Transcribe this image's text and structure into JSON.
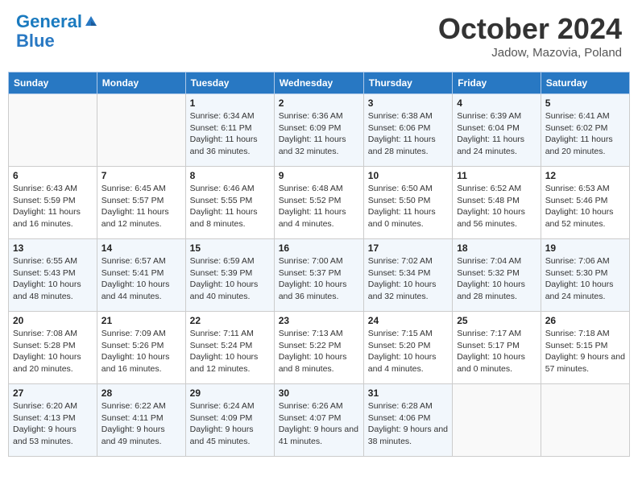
{
  "header": {
    "logo_line1": "General",
    "logo_line2": "Blue",
    "month_title": "October 2024",
    "subtitle": "Jadow, Mazovia, Poland"
  },
  "weekdays": [
    "Sunday",
    "Monday",
    "Tuesday",
    "Wednesday",
    "Thursday",
    "Friday",
    "Saturday"
  ],
  "weeks": [
    [
      {
        "day": "",
        "sunrise": "",
        "sunset": "",
        "daylight": ""
      },
      {
        "day": "",
        "sunrise": "",
        "sunset": "",
        "daylight": ""
      },
      {
        "day": "1",
        "sunrise": "Sunrise: 6:34 AM",
        "sunset": "Sunset: 6:11 PM",
        "daylight": "Daylight: 11 hours and 36 minutes."
      },
      {
        "day": "2",
        "sunrise": "Sunrise: 6:36 AM",
        "sunset": "Sunset: 6:09 PM",
        "daylight": "Daylight: 11 hours and 32 minutes."
      },
      {
        "day": "3",
        "sunrise": "Sunrise: 6:38 AM",
        "sunset": "Sunset: 6:06 PM",
        "daylight": "Daylight: 11 hours and 28 minutes."
      },
      {
        "day": "4",
        "sunrise": "Sunrise: 6:39 AM",
        "sunset": "Sunset: 6:04 PM",
        "daylight": "Daylight: 11 hours and 24 minutes."
      },
      {
        "day": "5",
        "sunrise": "Sunrise: 6:41 AM",
        "sunset": "Sunset: 6:02 PM",
        "daylight": "Daylight: 11 hours and 20 minutes."
      }
    ],
    [
      {
        "day": "6",
        "sunrise": "Sunrise: 6:43 AM",
        "sunset": "Sunset: 5:59 PM",
        "daylight": "Daylight: 11 hours and 16 minutes."
      },
      {
        "day": "7",
        "sunrise": "Sunrise: 6:45 AM",
        "sunset": "Sunset: 5:57 PM",
        "daylight": "Daylight: 11 hours and 12 minutes."
      },
      {
        "day": "8",
        "sunrise": "Sunrise: 6:46 AM",
        "sunset": "Sunset: 5:55 PM",
        "daylight": "Daylight: 11 hours and 8 minutes."
      },
      {
        "day": "9",
        "sunrise": "Sunrise: 6:48 AM",
        "sunset": "Sunset: 5:52 PM",
        "daylight": "Daylight: 11 hours and 4 minutes."
      },
      {
        "day": "10",
        "sunrise": "Sunrise: 6:50 AM",
        "sunset": "Sunset: 5:50 PM",
        "daylight": "Daylight: 11 hours and 0 minutes."
      },
      {
        "day": "11",
        "sunrise": "Sunrise: 6:52 AM",
        "sunset": "Sunset: 5:48 PM",
        "daylight": "Daylight: 10 hours and 56 minutes."
      },
      {
        "day": "12",
        "sunrise": "Sunrise: 6:53 AM",
        "sunset": "Sunset: 5:46 PM",
        "daylight": "Daylight: 10 hours and 52 minutes."
      }
    ],
    [
      {
        "day": "13",
        "sunrise": "Sunrise: 6:55 AM",
        "sunset": "Sunset: 5:43 PM",
        "daylight": "Daylight: 10 hours and 48 minutes."
      },
      {
        "day": "14",
        "sunrise": "Sunrise: 6:57 AM",
        "sunset": "Sunset: 5:41 PM",
        "daylight": "Daylight: 10 hours and 44 minutes."
      },
      {
        "day": "15",
        "sunrise": "Sunrise: 6:59 AM",
        "sunset": "Sunset: 5:39 PM",
        "daylight": "Daylight: 10 hours and 40 minutes."
      },
      {
        "day": "16",
        "sunrise": "Sunrise: 7:00 AM",
        "sunset": "Sunset: 5:37 PM",
        "daylight": "Daylight: 10 hours and 36 minutes."
      },
      {
        "day": "17",
        "sunrise": "Sunrise: 7:02 AM",
        "sunset": "Sunset: 5:34 PM",
        "daylight": "Daylight: 10 hours and 32 minutes."
      },
      {
        "day": "18",
        "sunrise": "Sunrise: 7:04 AM",
        "sunset": "Sunset: 5:32 PM",
        "daylight": "Daylight: 10 hours and 28 minutes."
      },
      {
        "day": "19",
        "sunrise": "Sunrise: 7:06 AM",
        "sunset": "Sunset: 5:30 PM",
        "daylight": "Daylight: 10 hours and 24 minutes."
      }
    ],
    [
      {
        "day": "20",
        "sunrise": "Sunrise: 7:08 AM",
        "sunset": "Sunset: 5:28 PM",
        "daylight": "Daylight: 10 hours and 20 minutes."
      },
      {
        "day": "21",
        "sunrise": "Sunrise: 7:09 AM",
        "sunset": "Sunset: 5:26 PM",
        "daylight": "Daylight: 10 hours and 16 minutes."
      },
      {
        "day": "22",
        "sunrise": "Sunrise: 7:11 AM",
        "sunset": "Sunset: 5:24 PM",
        "daylight": "Daylight: 10 hours and 12 minutes."
      },
      {
        "day": "23",
        "sunrise": "Sunrise: 7:13 AM",
        "sunset": "Sunset: 5:22 PM",
        "daylight": "Daylight: 10 hours and 8 minutes."
      },
      {
        "day": "24",
        "sunrise": "Sunrise: 7:15 AM",
        "sunset": "Sunset: 5:20 PM",
        "daylight": "Daylight: 10 hours and 4 minutes."
      },
      {
        "day": "25",
        "sunrise": "Sunrise: 7:17 AM",
        "sunset": "Sunset: 5:17 PM",
        "daylight": "Daylight: 10 hours and 0 minutes."
      },
      {
        "day": "26",
        "sunrise": "Sunrise: 7:18 AM",
        "sunset": "Sunset: 5:15 PM",
        "daylight": "Daylight: 9 hours and 57 minutes."
      }
    ],
    [
      {
        "day": "27",
        "sunrise": "Sunrise: 6:20 AM",
        "sunset": "Sunset: 4:13 PM",
        "daylight": "Daylight: 9 hours and 53 minutes."
      },
      {
        "day": "28",
        "sunrise": "Sunrise: 6:22 AM",
        "sunset": "Sunset: 4:11 PM",
        "daylight": "Daylight: 9 hours and 49 minutes."
      },
      {
        "day": "29",
        "sunrise": "Sunrise: 6:24 AM",
        "sunset": "Sunset: 4:09 PM",
        "daylight": "Daylight: 9 hours and 45 minutes."
      },
      {
        "day": "30",
        "sunrise": "Sunrise: 6:26 AM",
        "sunset": "Sunset: 4:07 PM",
        "daylight": "Daylight: 9 hours and 41 minutes."
      },
      {
        "day": "31",
        "sunrise": "Sunrise: 6:28 AM",
        "sunset": "Sunset: 4:06 PM",
        "daylight": "Daylight: 9 hours and 38 minutes."
      },
      {
        "day": "",
        "sunrise": "",
        "sunset": "",
        "daylight": ""
      },
      {
        "day": "",
        "sunrise": "",
        "sunset": "",
        "daylight": ""
      }
    ]
  ]
}
